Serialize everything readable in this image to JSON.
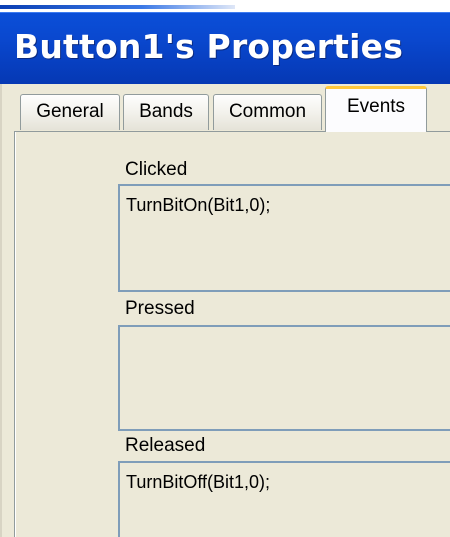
{
  "window": {
    "title": "Button1's Properties"
  },
  "tabs": [
    {
      "label": "General",
      "active": false
    },
    {
      "label": "Bands",
      "active": false
    },
    {
      "label": "Common",
      "active": false
    },
    {
      "label": "Events",
      "active": true
    }
  ],
  "events": {
    "clicked": {
      "label": "Clicked",
      "code": "TurnBitOn(Bit1,0);"
    },
    "pressed": {
      "label": "Pressed",
      "code": ""
    },
    "released": {
      "label": "Released",
      "code": "TurnBitOff(Bit1,0);"
    }
  },
  "colors": {
    "titlebar": "#0a48cf",
    "active_tab_accent": "#ffc83c",
    "field_border": "#7f9db9",
    "panel_bg": "#ece9d8"
  }
}
